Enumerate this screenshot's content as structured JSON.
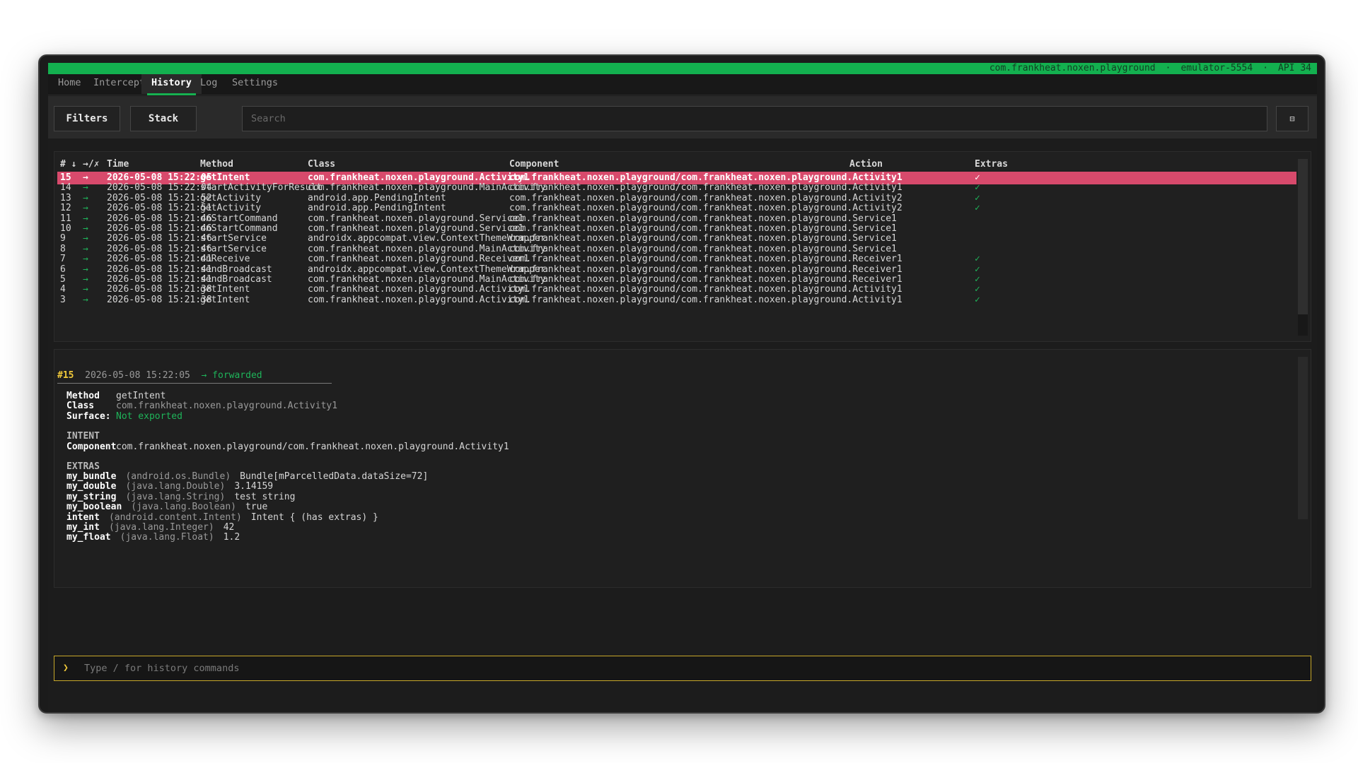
{
  "status": {
    "package": "com.frankheat.noxen.playground",
    "device": "emulator-5554",
    "api": "API 34",
    "separator": "·"
  },
  "tabs": [
    "Home",
    "Intercept",
    "History",
    "Log",
    "Settings"
  ],
  "active_tab": "History",
  "toolbar": {
    "filters_label": "Filters",
    "stack_label": "Stack",
    "search_placeholder": "Search",
    "layout_icon": "⊟"
  },
  "table": {
    "headers": {
      "num": "# ↓",
      "dir": "→/✗",
      "time": "Time",
      "method": "Method",
      "class": "Class",
      "component": "Component",
      "action": "Action",
      "extras": "Extras"
    },
    "rows": [
      {
        "num": "15",
        "dir": "→",
        "time": "2026-05-08 15:22:05",
        "method": "getIntent",
        "class": "com.frankheat.noxen.playground.Activity1",
        "component": "com.frankheat.noxen.playground/com.frankheat.noxen.playground.Activity1",
        "action": "",
        "extras": "✓"
      },
      {
        "num": "14",
        "dir": "→",
        "time": "2026-05-08 15:22:04",
        "method": "startActivityForResult",
        "class": "com.frankheat.noxen.playground.MainActivity",
        "component": "com.frankheat.noxen.playground/com.frankheat.noxen.playground.Activity1",
        "action": "",
        "extras": "✓"
      },
      {
        "num": "13",
        "dir": "→",
        "time": "2026-05-08 15:21:52",
        "method": "getActivity",
        "class": "android.app.PendingIntent",
        "component": "com.frankheat.noxen.playground/com.frankheat.noxen.playground.Activity2",
        "action": "",
        "extras": "✓"
      },
      {
        "num": "12",
        "dir": "→",
        "time": "2026-05-08 15:21:51",
        "method": "getActivity",
        "class": "android.app.PendingIntent",
        "component": "com.frankheat.noxen.playground/com.frankheat.noxen.playground.Activity2",
        "action": "",
        "extras": "✓"
      },
      {
        "num": "11",
        "dir": "→",
        "time": "2026-05-08 15:21:46",
        "method": "onStartCommand",
        "class": "com.frankheat.noxen.playground.Service1",
        "component": "com.frankheat.noxen.playground/com.frankheat.noxen.playground.Service1",
        "action": "",
        "extras": ""
      },
      {
        "num": "10",
        "dir": "→",
        "time": "2026-05-08 15:21:46",
        "method": "onStartCommand",
        "class": "com.frankheat.noxen.playground.Service1",
        "component": "com.frankheat.noxen.playground/com.frankheat.noxen.playground.Service1",
        "action": "",
        "extras": ""
      },
      {
        "num": "9",
        "dir": "→",
        "time": "2026-05-08 15:21:46",
        "method": "startService",
        "class": "androidx.appcompat.view.ContextThemeWrapper",
        "component": "com.frankheat.noxen.playground/com.frankheat.noxen.playground.Service1",
        "action": "",
        "extras": ""
      },
      {
        "num": "8",
        "dir": "→",
        "time": "2026-05-08 15:21:46",
        "method": "startService",
        "class": "com.frankheat.noxen.playground.MainActivity",
        "component": "com.frankheat.noxen.playground/com.frankheat.noxen.playground.Service1",
        "action": "",
        "extras": ""
      },
      {
        "num": "7",
        "dir": "→",
        "time": "2026-05-08 15:21:41",
        "method": "onReceive",
        "class": "com.frankheat.noxen.playground.Receiver1",
        "component": "com.frankheat.noxen.playground/com.frankheat.noxen.playground.Receiver1",
        "action": "",
        "extras": "✓"
      },
      {
        "num": "6",
        "dir": "→",
        "time": "2026-05-08 15:21:41",
        "method": "sendBroadcast",
        "class": "androidx.appcompat.view.ContextThemeWrapper",
        "component": "com.frankheat.noxen.playground/com.frankheat.noxen.playground.Receiver1",
        "action": "",
        "extras": "✓"
      },
      {
        "num": "5",
        "dir": "→",
        "time": "2026-05-08 15:21:41",
        "method": "sendBroadcast",
        "class": "com.frankheat.noxen.playground.MainActivity",
        "component": "com.frankheat.noxen.playground/com.frankheat.noxen.playground.Receiver1",
        "action": "",
        "extras": "✓"
      },
      {
        "num": "4",
        "dir": "→",
        "time": "2026-05-08 15:21:38",
        "method": "getIntent",
        "class": "com.frankheat.noxen.playground.Activity1",
        "component": "com.frankheat.noxen.playground/com.frankheat.noxen.playground.Activity1",
        "action": "",
        "extras": "✓"
      },
      {
        "num": "3",
        "dir": "→",
        "time": "2026-05-08 15:21:38",
        "method": "getIntent",
        "class": "com.frankheat.noxen.playground.Activity1",
        "component": "com.frankheat.noxen.playground/com.frankheat.noxen.playground.Activity1",
        "action": "",
        "extras": "✓"
      }
    ]
  },
  "detail": {
    "id": "#15",
    "time": "2026-05-08 15:22:05",
    "status": "→ forwarded",
    "fields": [
      {
        "label": "Method",
        "value": "getIntent",
        "value_style": "plain"
      },
      {
        "label": "Class",
        "value": "com.frankheat.noxen.playground.Activity1",
        "value_style": "muted"
      },
      {
        "label": "Surface:",
        "value": "Not exported",
        "value_style": "green"
      }
    ],
    "intent_title": "INTENT",
    "intent_component_label": "Component",
    "intent_component_value": "com.frankheat.noxen.playground/com.frankheat.noxen.playground.Activity1",
    "extras_title": "EXTRAS",
    "extras": [
      {
        "key": "my_bundle",
        "type": "(android.os.Bundle)",
        "value": "Bundle[mParcelledData.dataSize=72]"
      },
      {
        "key": "my_double",
        "type": "(java.lang.Double)",
        "value": "3.14159"
      },
      {
        "key": "my_string",
        "type": "(java.lang.String)",
        "value": "test string"
      },
      {
        "key": "my_boolean",
        "type": "(java.lang.Boolean)",
        "value": "true"
      },
      {
        "key": "intent",
        "type": "(android.content.Intent)",
        "value": "Intent { (has extras) }"
      },
      {
        "key": "my_int",
        "type": "(java.lang.Integer)",
        "value": "42"
      },
      {
        "key": "my_float",
        "type": "(java.lang.Float)",
        "value": "1.2"
      }
    ]
  },
  "command": {
    "prompt": "❯",
    "placeholder": "Type / for history commands"
  },
  "colors": {
    "accent_green": "#13b04f",
    "selected_row": "#d84a6c",
    "highlight_yellow": "#f0c93a"
  }
}
